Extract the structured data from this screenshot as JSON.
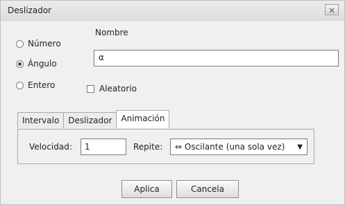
{
  "window": {
    "title": "Deslizador",
    "close_label": "×"
  },
  "type_options": [
    {
      "label": "Número",
      "selected": false
    },
    {
      "label": "Ángulo",
      "selected": true
    },
    {
      "label": "Entero",
      "selected": false
    }
  ],
  "name_field": {
    "label": "Nombre",
    "value": "α"
  },
  "random_checkbox": {
    "label": "Aleatorio",
    "checked": false
  },
  "tabs": [
    {
      "label": "Intervalo",
      "active": false
    },
    {
      "label": "Deslizador",
      "active": false
    },
    {
      "label": "Animación",
      "active": true
    }
  ],
  "animation": {
    "speed_label": "Velocidad:",
    "speed_value": "1",
    "repeat_label": "Repite:",
    "repeat_value": "⇔ Oscilante (una sola vez)"
  },
  "buttons": {
    "apply": "Aplica",
    "cancel": "Cancela"
  }
}
